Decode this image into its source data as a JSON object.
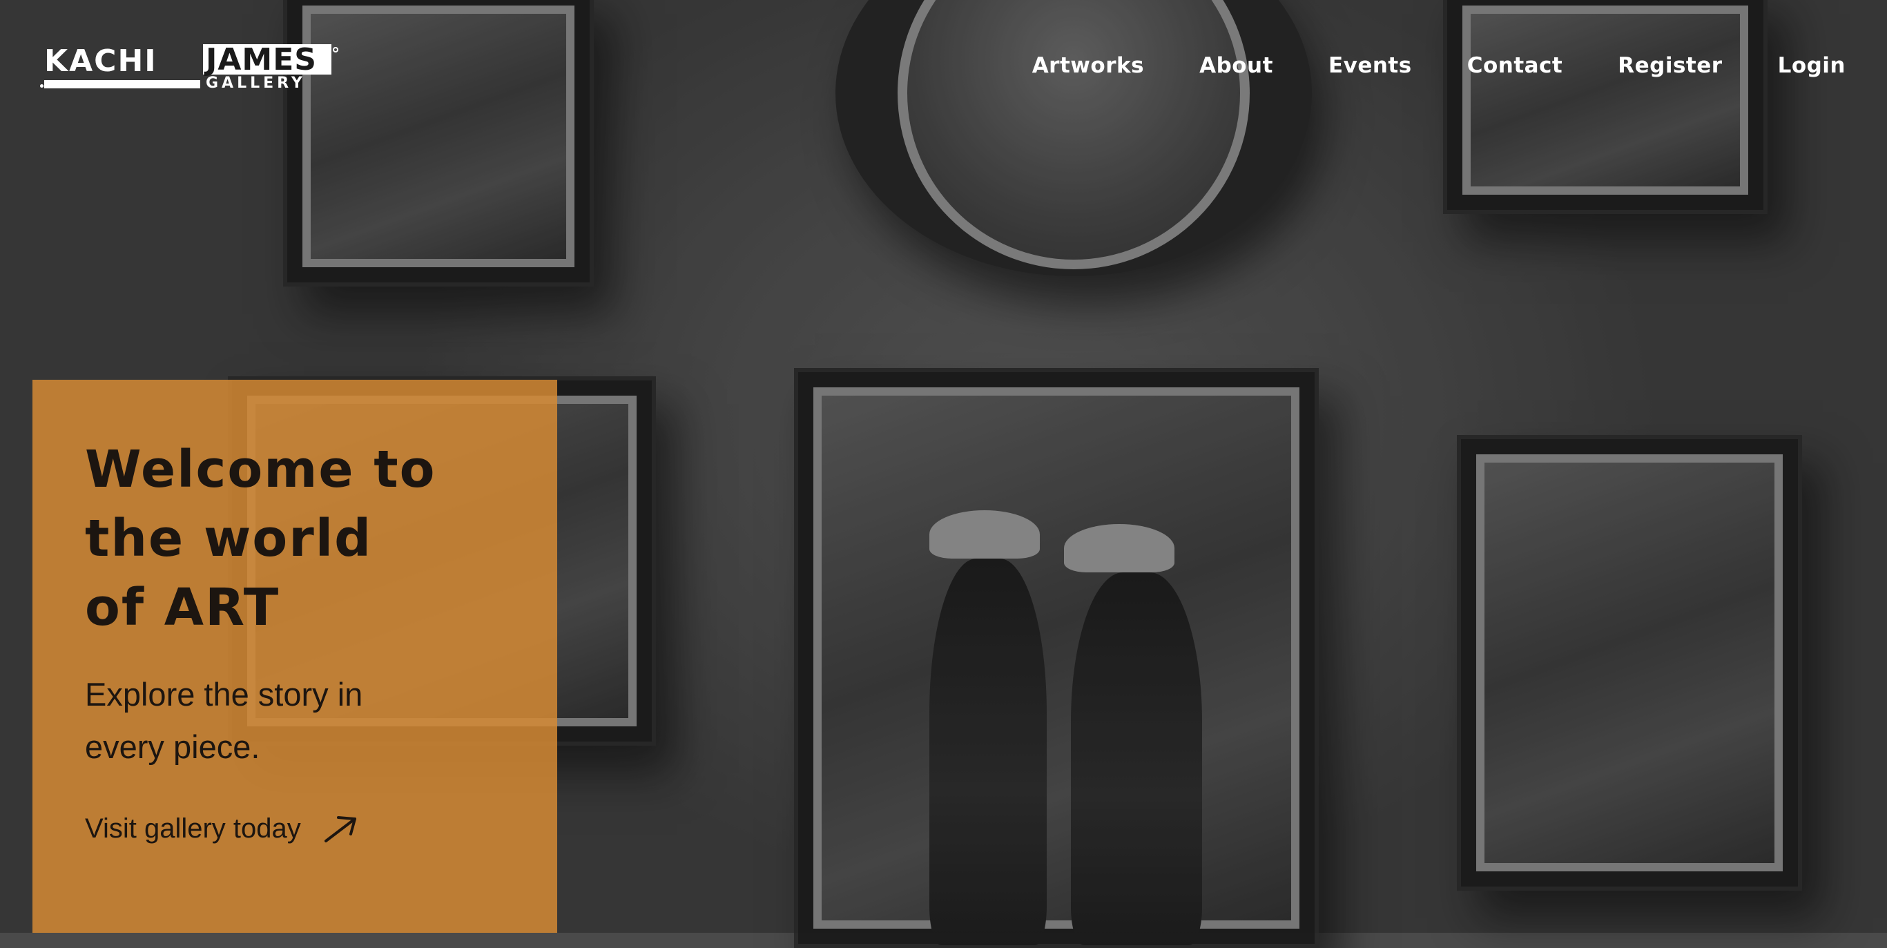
{
  "brand": {
    "name_part1": "KACHI",
    "name_part2": "JAMES",
    "tagline": "GALLERY"
  },
  "nav": {
    "items": [
      {
        "label": "Artworks"
      },
      {
        "label": "About"
      },
      {
        "label": "Events"
      },
      {
        "label": "Contact"
      },
      {
        "label": "Register"
      },
      {
        "label": "Login"
      }
    ]
  },
  "hero": {
    "heading_line1": "Welcome to",
    "heading_line2": "the world",
    "heading_line3": "of ART",
    "subtitle_line1": "Explore the story in",
    "subtitle_line2": "every piece.",
    "cta_label": "Visit gallery today",
    "cta_icon": "arrow-up-right-icon",
    "accent_color": "#D48934"
  },
  "background": {
    "image": "gallery-wall-photo"
  }
}
